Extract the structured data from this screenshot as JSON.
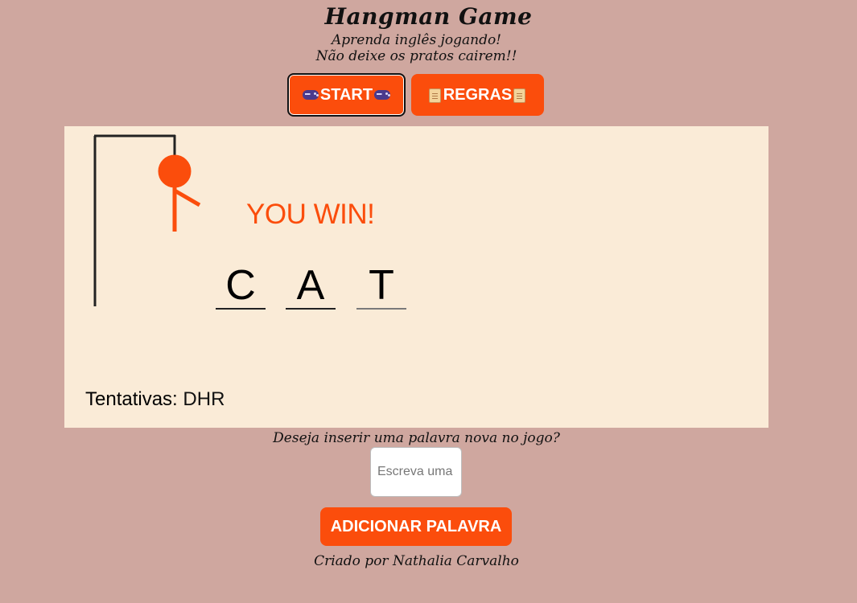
{
  "header": {
    "title": "Hangman Game",
    "subtitle_line1": "Aprenda inglês jogando!",
    "subtitle_line2": "Não deixe os pratos cairem!!"
  },
  "buttons": {
    "start_label": "START",
    "start_icon": "gamepad-icon",
    "rules_label": "REGRAS",
    "rules_icon": "scroll-icon"
  },
  "game": {
    "status_text": "YOU WIN!",
    "word_letters": [
      "C",
      "A",
      "T"
    ],
    "attempts_label": "Tentativas:",
    "attempts_letters": "DHR",
    "hangman_color": "#fb4d0c",
    "gallows_color": "#222222"
  },
  "add_word": {
    "question": "Deseja inserir uma palavra nova no jogo?",
    "input_placeholder": "Escreva uma palavra",
    "input_value": "",
    "button_label": "ADICIONAR PALAVRA"
  },
  "footer": {
    "credit": "Criado por Nathalia Carvalho"
  },
  "colors": {
    "background": "#cfa79f",
    "board": "#faebd7",
    "accent": "#fb4d0c"
  }
}
